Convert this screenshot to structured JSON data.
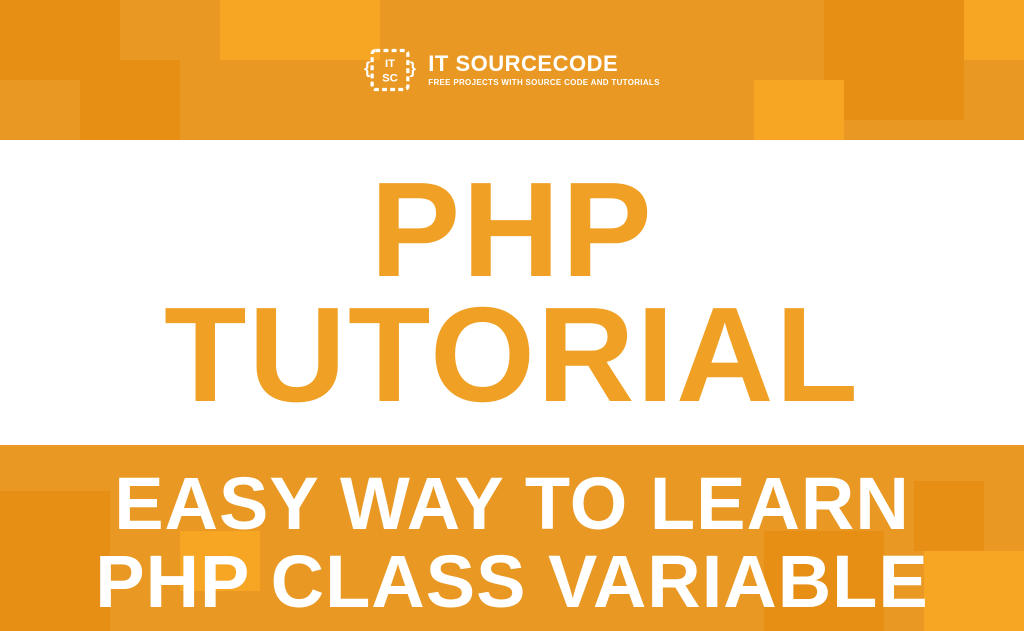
{
  "brand": {
    "name": "IT SOURCECODE",
    "tagline": "FREE PROJECTS WITH SOURCE CODE AND TUTORIALS"
  },
  "main": {
    "line1": "PHP",
    "line2": "TUTORIAL"
  },
  "subtitle": {
    "line1": "EASY WAY TO LEARN",
    "line2": "PHP CLASS VARIABLE"
  },
  "colors": {
    "primary_orange": "#e89823",
    "accent_orange": "#f0a024",
    "white": "#ffffff"
  }
}
